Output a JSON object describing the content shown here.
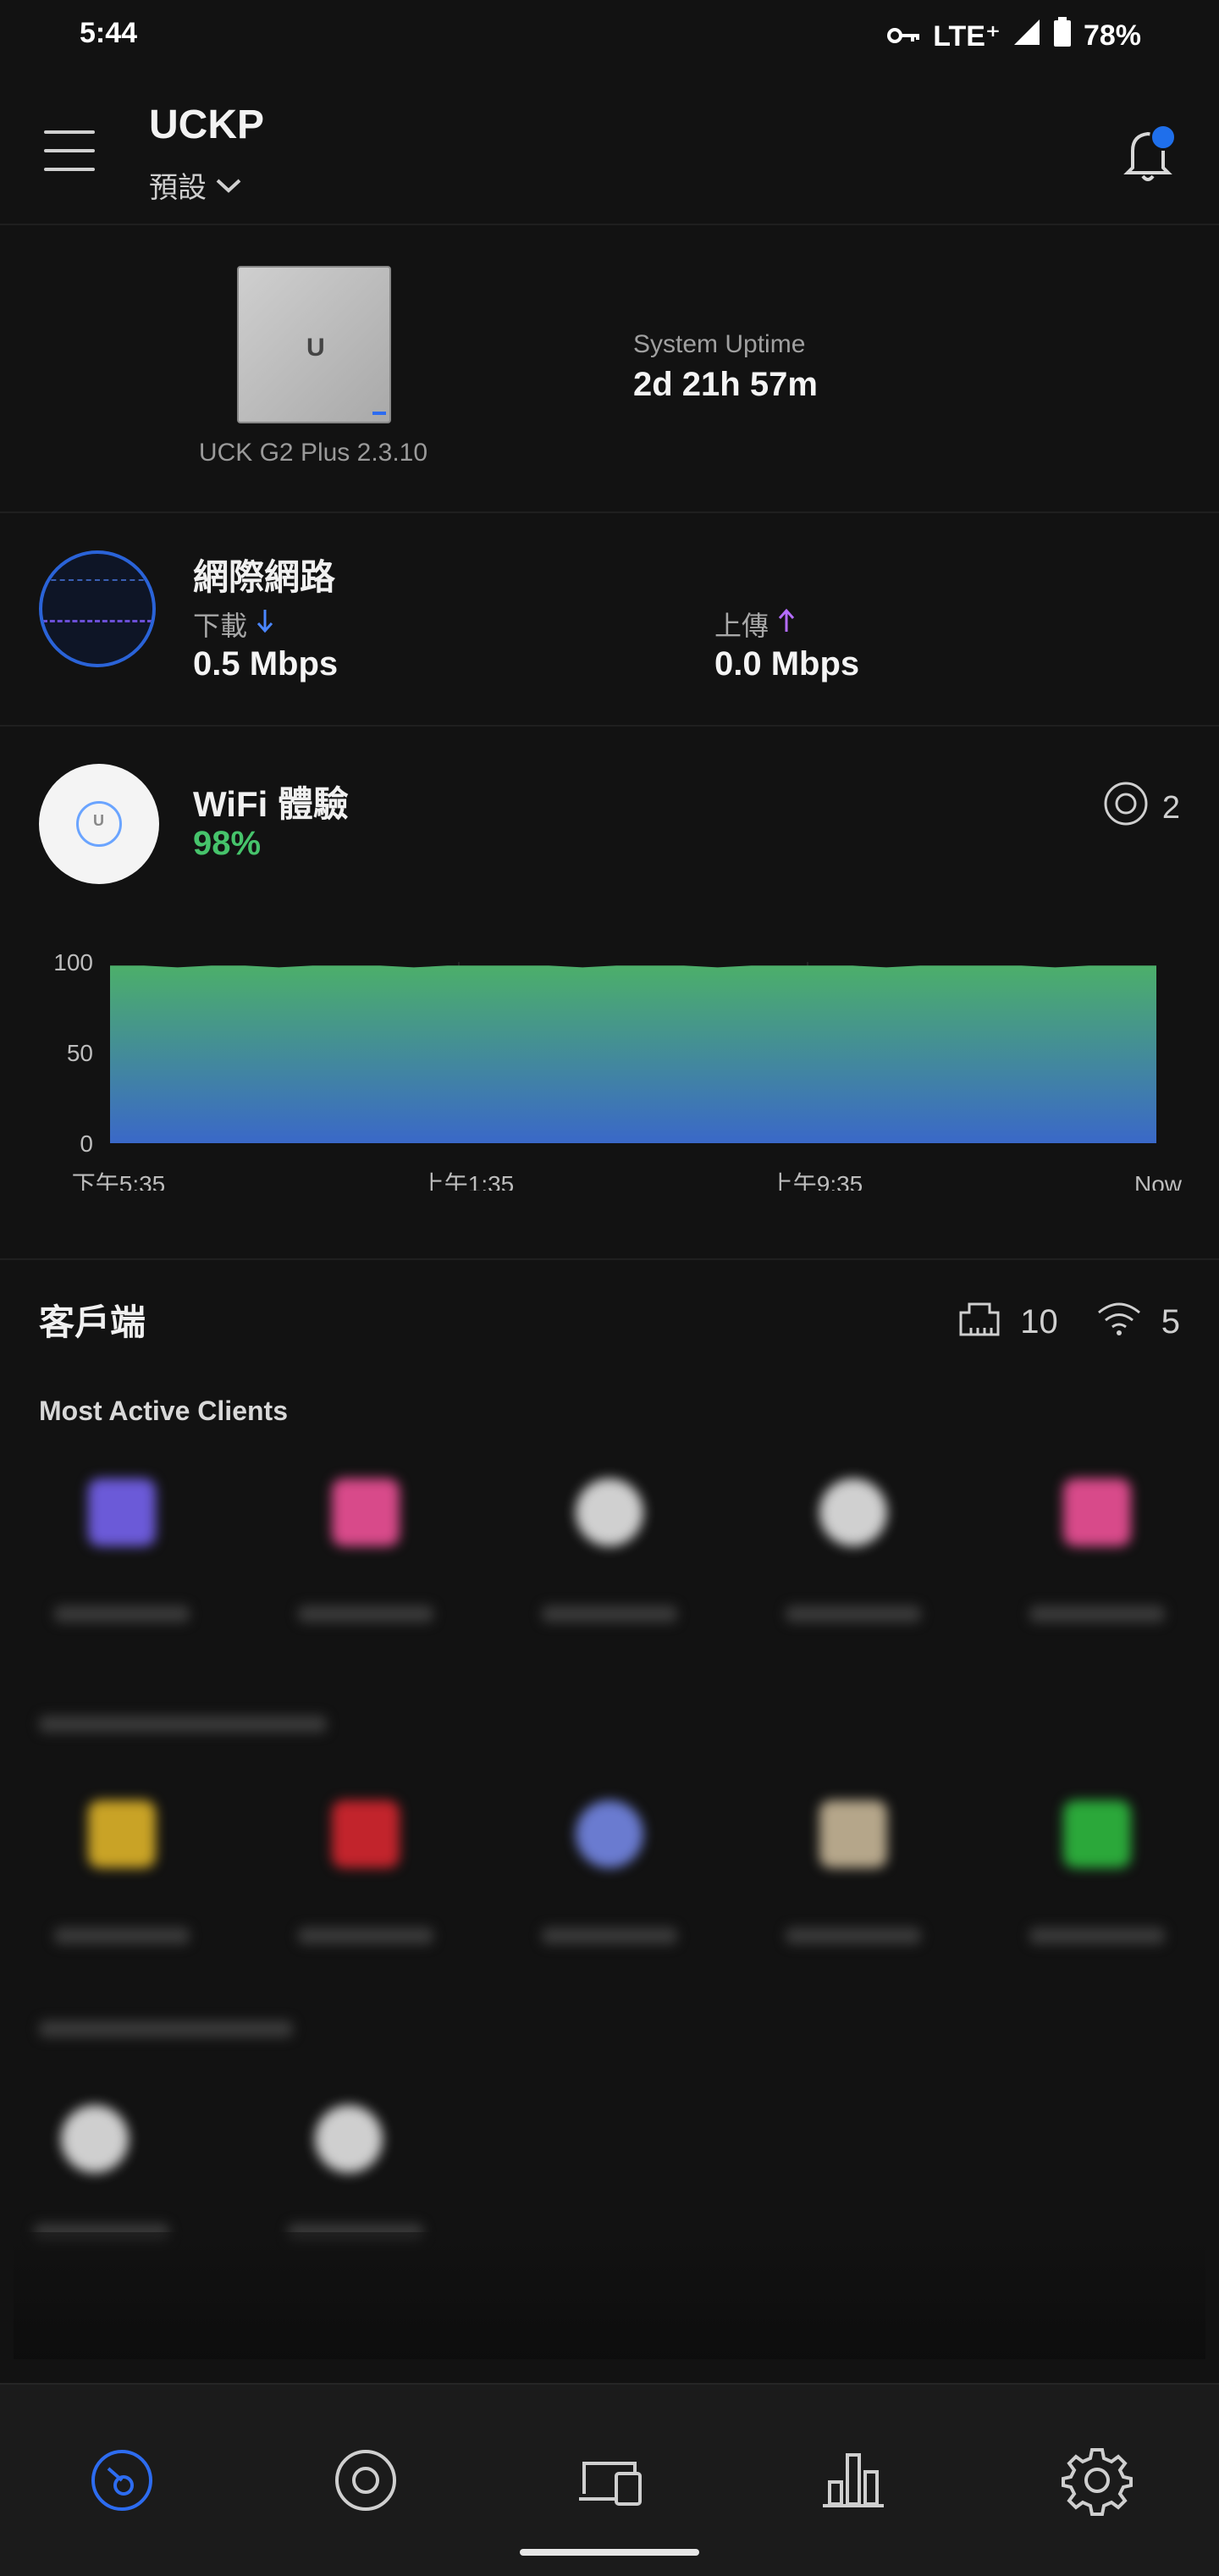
{
  "status_bar": {
    "time": "5:44",
    "network": "LTE⁺",
    "battery": "78%"
  },
  "header": {
    "title": "UCKP",
    "site": "預設"
  },
  "device": {
    "name": "UCK G2 Plus 2.3.10",
    "logo": "U",
    "uptime_label": "System Uptime",
    "uptime_value": "2d 21h 57m"
  },
  "internet": {
    "title": "網際網路",
    "download_label": "下載",
    "download_value": "0.5 Mbps",
    "upload_label": "上傳",
    "upload_value": "0.0 Mbps",
    "download_color": "#4a86ff",
    "upload_color": "#b46cff"
  },
  "wifi": {
    "title": "WiFi 體驗",
    "score": "98%",
    "ap_count": "2",
    "ap_logo": "U"
  },
  "chart_data": {
    "type": "area",
    "x_labels": [
      "下午5:35",
      "上午1:35",
      "上午9:35",
      "Now"
    ],
    "y_ticks": [
      100,
      50,
      0
    ],
    "ylim": [
      0,
      100
    ],
    "values": [
      98,
      98,
      97,
      98,
      98,
      97,
      98,
      98,
      98,
      97,
      98,
      98,
      98,
      98,
      97,
      98,
      98,
      98,
      97,
      98,
      98,
      98,
      98,
      97,
      98,
      98,
      98,
      98,
      97,
      98,
      98,
      98
    ],
    "fill_top": "#4caf6a",
    "fill_bottom": "#3a68c8"
  },
  "clients": {
    "title": "客戶端",
    "wired_count": "10",
    "wireless_count": "5",
    "most_active_label": "Most Active Clients"
  }
}
